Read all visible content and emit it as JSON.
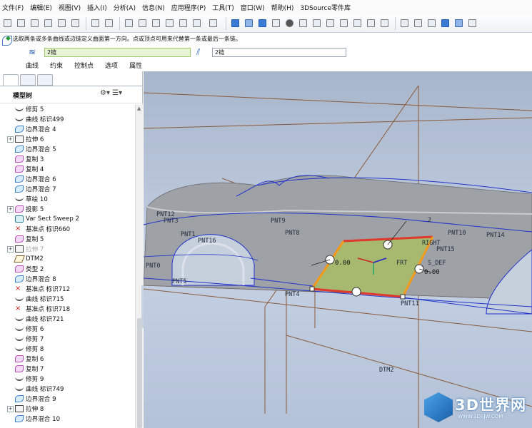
{
  "menu": [
    "文件(F)",
    "编辑(E)",
    "视图(V)",
    "插入(I)",
    "分析(A)",
    "信息(N)",
    "应用程序(P)",
    "工具(T)",
    "窗口(W)",
    "帮助(H)",
    "3DSource零件库"
  ],
  "dashboard": {
    "message": "选取两条或多条曲线或边链定义曲面第一方向。点或顶点可用来代替第一条或最后一条链。",
    "field1_value": "2链",
    "field2_value": "2链",
    "tabs": [
      "曲线",
      "约束",
      "控制点",
      "选项",
      "属性"
    ]
  },
  "left_panel": {
    "title": "模型树",
    "items": [
      {
        "icon": "curve",
        "label": "修剪 5",
        "exp": false
      },
      {
        "icon": "curve",
        "label": "曲线 标识499",
        "exp": false
      },
      {
        "icon": "bound",
        "label": "边界混合 4",
        "exp": false
      },
      {
        "icon": "extrude",
        "label": "拉伸 6",
        "exp": true
      },
      {
        "icon": "bound",
        "label": "边界混合 5",
        "exp": false
      },
      {
        "icon": "copy",
        "label": "复制 3",
        "exp": false
      },
      {
        "icon": "copy",
        "label": "复制 4",
        "exp": false
      },
      {
        "icon": "bound",
        "label": "边界混合 6",
        "exp": false
      },
      {
        "icon": "bound",
        "label": "边界混合 7",
        "exp": false
      },
      {
        "icon": "curve",
        "label": "草绘 10",
        "exp": false
      },
      {
        "icon": "copy",
        "label": "投影 5",
        "exp": true
      },
      {
        "icon": "sweep",
        "label": "Var Sect Sweep 2",
        "exp": false
      },
      {
        "icon": "point",
        "label": "基准点 标识660",
        "exp": false
      },
      {
        "icon": "copy",
        "label": "复制 5",
        "exp": false
      },
      {
        "icon": "extrude",
        "label": "拉伸 7",
        "exp": true,
        "dim": true
      },
      {
        "icon": "datum",
        "label": "DTM2",
        "exp": false
      },
      {
        "icon": "copy",
        "label": "类型 2",
        "exp": false
      },
      {
        "icon": "bound",
        "label": "边界混合 8",
        "exp": false
      },
      {
        "icon": "point",
        "label": "基准点 标识712",
        "exp": false
      },
      {
        "icon": "curve",
        "label": "曲线 标识715",
        "exp": false
      },
      {
        "icon": "point",
        "label": "基准点 标识718",
        "exp": false
      },
      {
        "icon": "curve",
        "label": "曲线 标识721",
        "exp": false
      },
      {
        "icon": "curve",
        "label": "修剪 6",
        "exp": false
      },
      {
        "icon": "curve",
        "label": "修剪 7",
        "exp": false
      },
      {
        "icon": "curve",
        "label": "修剪 8",
        "exp": false
      },
      {
        "icon": "copy",
        "label": "复制 6",
        "exp": false
      },
      {
        "icon": "copy",
        "label": "复制 7",
        "exp": false
      },
      {
        "icon": "curve",
        "label": "修剪 9",
        "exp": false
      },
      {
        "icon": "curve",
        "label": "曲线 标识749",
        "exp": false
      },
      {
        "icon": "bound",
        "label": "边界混合 9",
        "exp": false
      },
      {
        "icon": "extrude",
        "label": "拉伸 8",
        "exp": true
      },
      {
        "icon": "bound",
        "label": "边界混合 10",
        "exp": false
      }
    ]
  },
  "viewport": {
    "labels": [
      "PNT12",
      "PNT3",
      "PNT1",
      "PNT16",
      "PNT0",
      "PNT5",
      "PNT8",
      "PNT9",
      "PNT4",
      "PNT10",
      "PNT14",
      "PNT15",
      "PNT11",
      "RIGHT",
      "FRT",
      "S_DEF",
      "DTM2",
      "2"
    ],
    "dims": [
      "0.00",
      "0.00"
    ],
    "colors": {
      "surface": "#9ea1a6",
      "patch": "#a6bb6c",
      "edge_orange": "#f39a1c",
      "edge_red": "#e0382a",
      "curve_blue": "#2233cc",
      "datum_brown": "#8a5a3a"
    }
  },
  "watermark": {
    "text": "3D世界网",
    "url": "WWW.3DSJW.COM"
  }
}
